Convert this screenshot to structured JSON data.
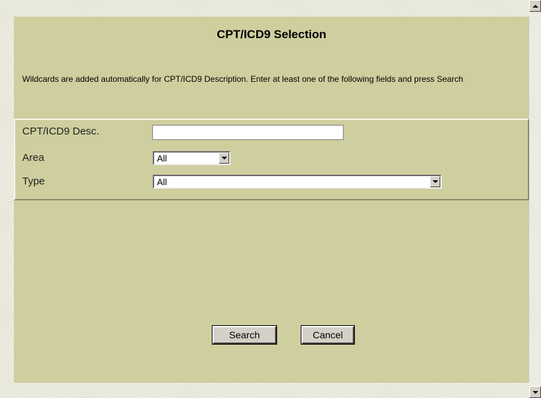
{
  "dialog": {
    "title": "CPT/ICD9 Selection",
    "instructions": "Wildcards are added automatically for CPT/ICD9 Description. Enter at least one of the following fields and press Search"
  },
  "form": {
    "desc": {
      "label": "CPT/ICD9 Desc.",
      "value": ""
    },
    "area": {
      "label": "Area",
      "selected": "All"
    },
    "type": {
      "label": "Type",
      "selected": "All"
    }
  },
  "buttons": {
    "search": "Search",
    "cancel": "Cancel"
  },
  "icons": {
    "dropdown": "chevron-down-icon",
    "scroll_up": "arrow-up-icon",
    "scroll_down": "arrow-down-icon"
  },
  "colors": {
    "panel": "#cece9f",
    "page_background": "#e9e9dc",
    "button_face": "#d4d0c8"
  }
}
